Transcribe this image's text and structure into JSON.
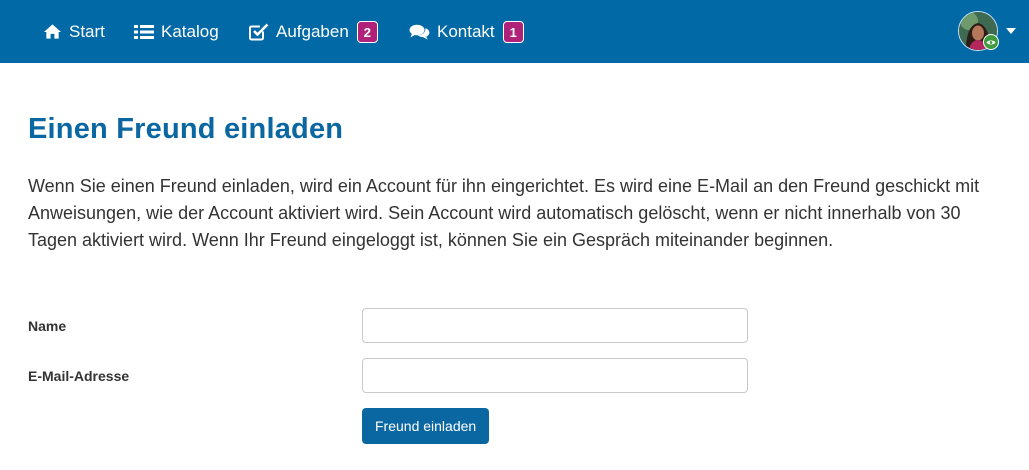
{
  "nav": {
    "items": [
      {
        "label": "Start",
        "icon": "home-icon"
      },
      {
        "label": "Katalog",
        "icon": "list-icon"
      },
      {
        "label": "Aufgaben",
        "icon": "check-square-icon",
        "badge": "2"
      },
      {
        "label": "Kontakt",
        "icon": "comments-icon",
        "badge": "1"
      }
    ],
    "user_menu": {
      "avatar": "user-avatar",
      "status_icon": "eye-icon",
      "caret_icon": "caret-down-icon"
    }
  },
  "page": {
    "title": "Einen Freund einladen",
    "intro": "Wenn Sie einen Freund einladen, wird ein Account für ihn eingerichtet. Es wird eine E-Mail an den Freund geschickt mit Anweisungen, wie der Account aktiviert wird. Sein Account wird automatisch gelöscht, wenn er nicht innerhalb von 30 Tagen aktiviert wird. Wenn Ihr Freund eingeloggt ist, können Sie ein Gespräch miteinander beginnen."
  },
  "form": {
    "name_label": "Name",
    "name_value": "",
    "email_label": "E-Mail-Adresse",
    "email_value": "",
    "submit_label": "Freund einladen"
  },
  "colors": {
    "navbar": "#0069a6",
    "badge": "#b0217a",
    "title": "#0b67a1",
    "button": "#0b67a1"
  }
}
